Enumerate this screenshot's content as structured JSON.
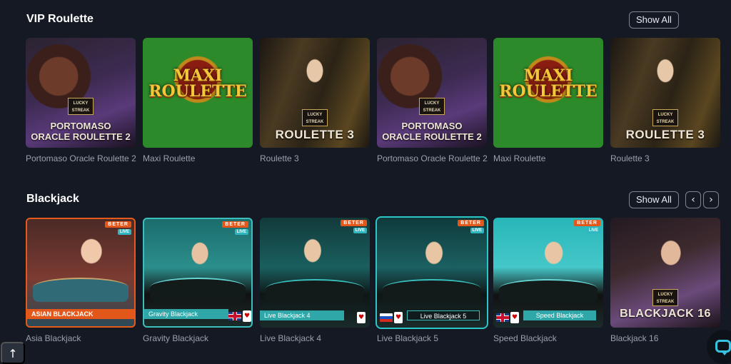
{
  "vip": {
    "title": "VIP Roulette",
    "show_all": "Show All",
    "games": [
      {
        "name": "Portomaso Oracle Roulette 2",
        "brand": "LUCKY STREAK",
        "thumb_line1": "PORTOMASO",
        "thumb_line2": "ORACLE ROULETTE 2"
      },
      {
        "name": "Maxi Roulette",
        "thumb_line1": "MAXI",
        "thumb_line2": "ROULETTE"
      },
      {
        "name": "Roulette 3",
        "brand": "LUCKY STREAK",
        "thumb_title": "ROULETTE 3"
      },
      {
        "name": "Portomaso Oracle Roulette 2",
        "brand": "LUCKY STREAK",
        "thumb_line1": "PORTOMASO",
        "thumb_line2": "ORACLE ROULETTE 2"
      },
      {
        "name": "Maxi Roulette",
        "thumb_line1": "MAXI",
        "thumb_line2": "ROULETTE"
      },
      {
        "name": "Roulette 3",
        "brand": "LUCKY STREAK",
        "thumb_title": "ROULETTE 3"
      }
    ]
  },
  "blackjack": {
    "title": "Blackjack",
    "show_all": "Show All",
    "prev": "‹",
    "next": "›",
    "badge_provider": "BETER",
    "badge_live": "LIVE",
    "games": [
      {
        "name": "Asia Blackjack",
        "banner": "ASIAN BLACKJACK"
      },
      {
        "name": "Gravity Blackjack",
        "banner": "Gravity Blackjack"
      },
      {
        "name": "Live Blackjack 4",
        "banner": "Live Blackjack 4"
      },
      {
        "name": "Live Blackjack 5",
        "banner": "Live Blackjack 5"
      },
      {
        "name": "Speed Blackjack",
        "banner": "Speed Blackjack"
      },
      {
        "name": "Blackjack 16",
        "brand": "LUCKY STREAK",
        "thumb_title": "BLACKJACK 16"
      }
    ]
  },
  "scroll_top": "↑",
  "card_suit": "♥"
}
